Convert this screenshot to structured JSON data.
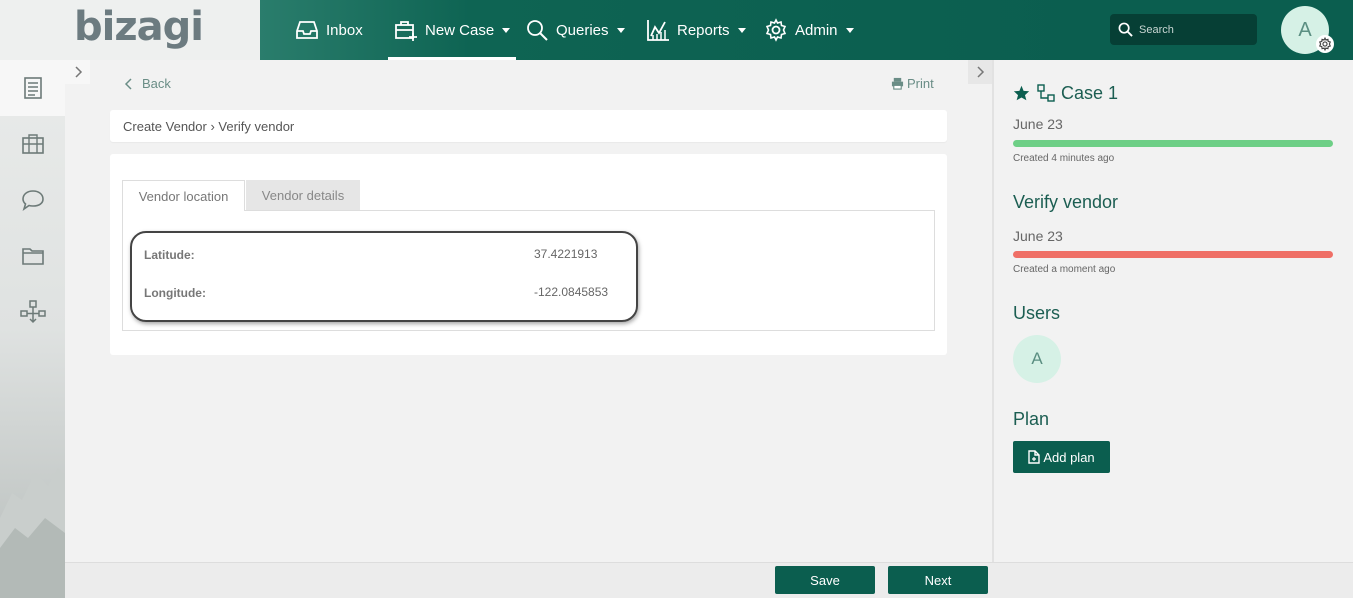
{
  "brand": {
    "logo_text": "bizagi"
  },
  "nav": {
    "items": [
      {
        "label": "Inbox",
        "icon": "inbox-icon",
        "dropdown": false
      },
      {
        "label": "New Case",
        "icon": "new-case-icon",
        "dropdown": true,
        "active": true
      },
      {
        "label": "Queries",
        "icon": "search-icon",
        "dropdown": true
      },
      {
        "label": "Reports",
        "icon": "reports-chart-icon",
        "dropdown": true
      },
      {
        "label": "Admin",
        "icon": "gear-icon",
        "dropdown": true
      }
    ]
  },
  "search": {
    "placeholder": "Search"
  },
  "user": {
    "initial": "A"
  },
  "rail": {
    "items": [
      {
        "icon": "work-items-list-icon",
        "active": true
      },
      {
        "icon": "briefcase-icon"
      },
      {
        "icon": "chat-icon"
      },
      {
        "icon": "folder-icon"
      },
      {
        "icon": "process-flow-icon"
      }
    ]
  },
  "main": {
    "back_label": "Back",
    "print_label": "Print",
    "breadcrumb": "Create Vendor › Verify vendor",
    "tabs": [
      {
        "label": "Vendor location",
        "active": true
      },
      {
        "label": "Vendor details",
        "active": false
      }
    ],
    "fields": [
      {
        "label": "Latitude:",
        "value": "37.4221913"
      },
      {
        "label": "Longitude:",
        "value": "-122.0845853"
      }
    ]
  },
  "right_panel": {
    "case_title": "Case 1",
    "case_date": "June 23",
    "case_created": "Created 4 minutes ago",
    "task_title": "Verify vendor",
    "task_date": "June 23",
    "task_created": "Created a moment ago",
    "users_heading": "Users",
    "user_initial": "A",
    "plan_heading": "Plan",
    "add_plan_label": "Add plan"
  },
  "footer": {
    "save_label": "Save",
    "next_label": "Next"
  },
  "colors": {
    "primary": "#0b5e4f",
    "case_bar": "#6ecf86",
    "task_bar": "#ef6f66",
    "avatar_bg": "#d6f1e6"
  }
}
